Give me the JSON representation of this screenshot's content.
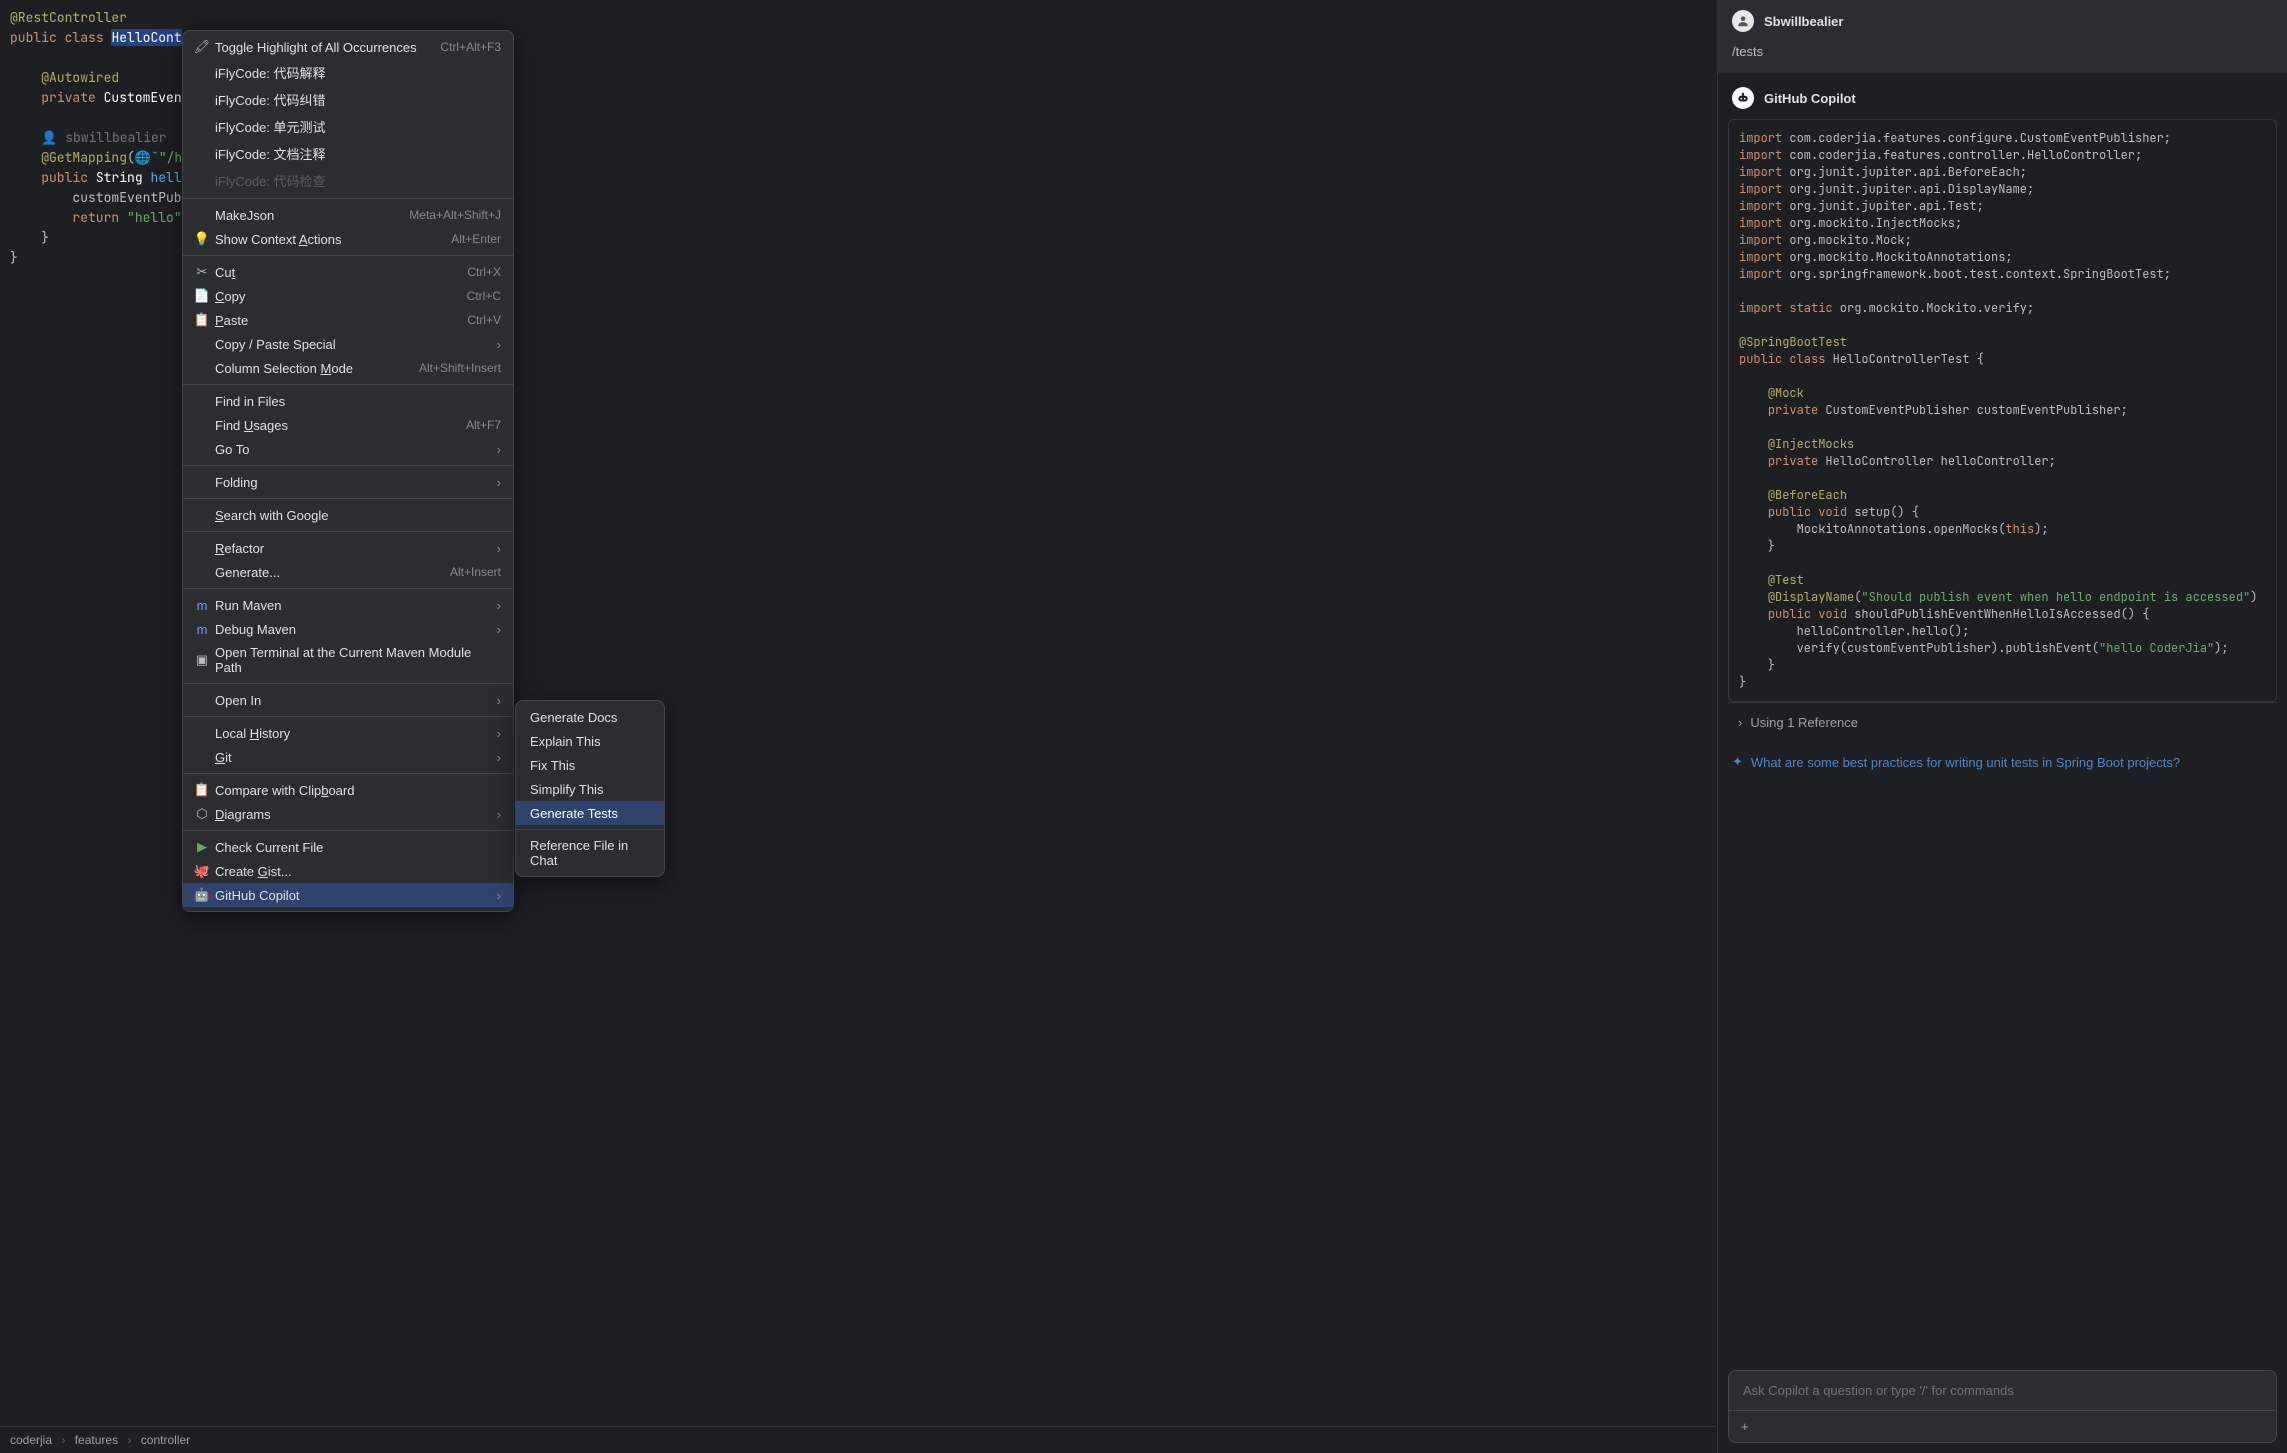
{
  "editor": {
    "line1_anno": "@RestController",
    "line2_kw1": "public",
    "line2_kw2": "class",
    "line2_cls": "HelloCont",
    "line4_autowired": "@Autowired",
    "line5_kw": "private",
    "line5_type": "CustomEvent",
    "author_glyph": "👤",
    "author_name": "sbwillbealier",
    "getmapping_anno": "@GetMapping",
    "getmapping_globe": "🌐ˇ",
    "getmapping_path": "\"/he",
    "hello_kw1": "public",
    "hello_type": "String",
    "hello_name": "hell",
    "hello_body1": "customEventPubl",
    "hello_ret_kw": "return",
    "hello_ret_str": "\"hello\"",
    "close1": "}",
    "close2": "}",
    "breadcrumb_parts": [
      "coderjia",
      "features",
      "controller"
    ]
  },
  "menu": [
    {
      "icon": "🖍",
      "label": "Toggle Highlight of All Occurrences",
      "shortcut": "Ctrl+Alt+F3"
    },
    {
      "label": "iFlyCode: 代码解释"
    },
    {
      "label": "iFlyCode: 代码纠错"
    },
    {
      "label": "iFlyCode: 单元测试"
    },
    {
      "label": "iFlyCode: 文档注释"
    },
    {
      "label": "iFlyCode: 代码检查",
      "disabled": true
    },
    {
      "sep": true
    },
    {
      "label": "MakeJson",
      "shortcut": "Meta+Alt+Shift+J"
    },
    {
      "icon": "💡",
      "label_html": "Show Context <u>A</u>ctions",
      "shortcut": "Alt+Enter"
    },
    {
      "sep": true
    },
    {
      "icon": "✂",
      "label_html": "Cu<u>t</u>",
      "shortcut": "Ctrl+X"
    },
    {
      "icon": "📄",
      "label_html": "<u>C</u>opy",
      "shortcut": "Ctrl+C"
    },
    {
      "icon": "📋",
      "label_html": "<u>P</u>aste",
      "shortcut": "Ctrl+V"
    },
    {
      "label": "Copy / Paste Special",
      "submenu": true
    },
    {
      "label_html": "Column Selection <u>M</u>ode",
      "shortcut": "Alt+Shift+Insert"
    },
    {
      "sep": true
    },
    {
      "label": "Find in Files"
    },
    {
      "label_html": "Find <u>U</u>sages",
      "shortcut": "Alt+F7"
    },
    {
      "label": "Go To",
      "submenu": true
    },
    {
      "sep": true
    },
    {
      "label": "Folding",
      "submenu": true
    },
    {
      "sep": true
    },
    {
      "label_html": "<u>S</u>earch with Google"
    },
    {
      "sep": true
    },
    {
      "label_html": "<u>R</u>efactor",
      "submenu": true
    },
    {
      "label": "Generate...",
      "shortcut": "Alt+Insert"
    },
    {
      "sep": true
    },
    {
      "icon": "m",
      "label": "Run Maven",
      "submenu": true,
      "icon_color": "#6c9ef8"
    },
    {
      "icon": "m",
      "label": "Debug Maven",
      "submenu": true,
      "icon_color": "#6c9ef8"
    },
    {
      "icon": "▣",
      "label": "Open Terminal at the Current Maven Module Path"
    },
    {
      "sep": true
    },
    {
      "label": "Open In",
      "submenu": true
    },
    {
      "sep": true
    },
    {
      "label_html": "Local <u>H</u>istory",
      "submenu": true
    },
    {
      "label_html": "<u>G</u>it",
      "submenu": true
    },
    {
      "sep": true
    },
    {
      "icon": "📋",
      "label_html": "Compare with Clip<u>b</u>oard"
    },
    {
      "icon": "⬡",
      "label_html": "<u>D</u>iagrams",
      "submenu": true
    },
    {
      "sep": true
    },
    {
      "icon": "▶",
      "label": "Check Current File",
      "icon_color": "#5fad65"
    },
    {
      "icon": "🐙",
      "label_html": "Create <u>G</u>ist..."
    },
    {
      "icon": "🤖",
      "label": "GitHub Copilot",
      "submenu": true,
      "highlighted": true
    }
  ],
  "submenu_items": [
    {
      "label": "Generate Docs"
    },
    {
      "label": "Explain This"
    },
    {
      "label": "Fix This"
    },
    {
      "label": "Simplify This"
    },
    {
      "label": "Generate Tests",
      "highlighted": true
    },
    {
      "sep": true
    },
    {
      "label": "Reference File in Chat"
    }
  ],
  "copilot": {
    "user_name": "Sbwillbealier",
    "user_message": "/tests",
    "copilot_name": "GitHub Copilot",
    "references_text": "Using 1 Reference",
    "suggestion_text": "What are some best practices for writing unit tests in Spring Boot projects?",
    "input_placeholder": "Ask Copilot a question or type '/' for commands",
    "plus_icon": "+",
    "code_lines": [
      {
        "tokens": [
          [
            "k",
            "import"
          ],
          [
            "t",
            " com.coderjia.features.configure.CustomEventPublisher;"
          ]
        ]
      },
      {
        "tokens": [
          [
            "k",
            "import"
          ],
          [
            "t",
            " com.coderjia.features.controller.HelloController;"
          ]
        ]
      },
      {
        "tokens": [
          [
            "k",
            "import"
          ],
          [
            "t",
            " org.junit.jupiter.api.BeforeEach;"
          ]
        ]
      },
      {
        "tokens": [
          [
            "k",
            "import"
          ],
          [
            "t",
            " org.junit.jupiter.api.DisplayName;"
          ]
        ]
      },
      {
        "tokens": [
          [
            "k",
            "import"
          ],
          [
            "t",
            " org.junit.jupiter.api.Test;"
          ]
        ]
      },
      {
        "tokens": [
          [
            "k",
            "import"
          ],
          [
            "t",
            " org.mockito.InjectMocks;"
          ]
        ]
      },
      {
        "tokens": [
          [
            "k",
            "import"
          ],
          [
            "t",
            " org.mockito.Mock;"
          ]
        ]
      },
      {
        "tokens": [
          [
            "k",
            "import"
          ],
          [
            "t",
            " org.mockito.MockitoAnnotations;"
          ]
        ]
      },
      {
        "tokens": [
          [
            "k",
            "import"
          ],
          [
            "t",
            " org.springframework.boot.test.context.SpringBootTest;"
          ]
        ]
      },
      {
        "tokens": [
          [
            "t",
            ""
          ]
        ]
      },
      {
        "tokens": [
          [
            "k",
            "import static"
          ],
          [
            "t",
            " org.mockito.Mockito.verify;"
          ]
        ]
      },
      {
        "tokens": [
          [
            "t",
            ""
          ]
        ]
      },
      {
        "tokens": [
          [
            "ann",
            "@SpringBootTest"
          ]
        ]
      },
      {
        "tokens": [
          [
            "k",
            "public class"
          ],
          [
            "t",
            " HelloControllerTest {"
          ]
        ]
      },
      {
        "tokens": [
          [
            "t",
            ""
          ]
        ]
      },
      {
        "tokens": [
          [
            "t",
            "    "
          ],
          [
            "ann",
            "@Mock"
          ]
        ]
      },
      {
        "tokens": [
          [
            "t",
            "    "
          ],
          [
            "k",
            "private"
          ],
          [
            "t",
            " CustomEventPublisher customEventPublisher;"
          ]
        ]
      },
      {
        "tokens": [
          [
            "t",
            ""
          ]
        ]
      },
      {
        "tokens": [
          [
            "t",
            "    "
          ],
          [
            "ann",
            "@InjectMocks"
          ]
        ]
      },
      {
        "tokens": [
          [
            "t",
            "    "
          ],
          [
            "k",
            "private"
          ],
          [
            "t",
            " HelloController helloController;"
          ]
        ]
      },
      {
        "tokens": [
          [
            "t",
            ""
          ]
        ]
      },
      {
        "tokens": [
          [
            "t",
            "    "
          ],
          [
            "ann",
            "@BeforeEach"
          ]
        ]
      },
      {
        "tokens": [
          [
            "t",
            "    "
          ],
          [
            "k",
            "public void"
          ],
          [
            "t",
            " setup() {"
          ]
        ]
      },
      {
        "tokens": [
          [
            "t",
            "        MockitoAnnotations.openMocks("
          ],
          [
            "k",
            "this"
          ],
          [
            "t",
            ");"
          ]
        ]
      },
      {
        "tokens": [
          [
            "t",
            "    }"
          ]
        ]
      },
      {
        "tokens": [
          [
            "t",
            ""
          ]
        ]
      },
      {
        "tokens": [
          [
            "t",
            "    "
          ],
          [
            "ann",
            "@Test"
          ]
        ]
      },
      {
        "tokens": [
          [
            "t",
            "    "
          ],
          [
            "ann",
            "@DisplayName"
          ],
          [
            "t",
            "("
          ],
          [
            "s",
            "\"Should publish event when hello endpoint is accessed\""
          ],
          [
            "t",
            ")"
          ]
        ]
      },
      {
        "tokens": [
          [
            "t",
            "    "
          ],
          [
            "k",
            "public void"
          ],
          [
            "t",
            " shouldPublishEventWhenHelloIsAccessed() {"
          ]
        ]
      },
      {
        "tokens": [
          [
            "t",
            "        helloController.hello();"
          ]
        ]
      },
      {
        "tokens": [
          [
            "t",
            "        verify(customEventPublisher).publishEvent("
          ],
          [
            "s",
            "\"hello CoderJia\""
          ],
          [
            "t",
            ");"
          ]
        ]
      },
      {
        "tokens": [
          [
            "t",
            "    }"
          ]
        ]
      },
      {
        "tokens": [
          [
            "t",
            "}"
          ]
        ]
      }
    ]
  }
}
